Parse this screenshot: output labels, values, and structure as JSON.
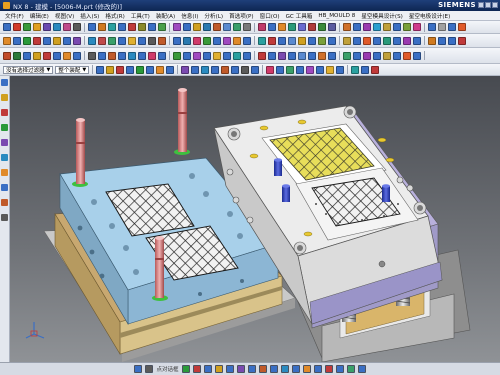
{
  "window": {
    "title": "NX 8 - 建模 - [5006-M.prt (修改的)]",
    "brand": "SIEMENS"
  },
  "menu": {
    "items": [
      "文件(F)",
      "编辑(E)",
      "视图(V)",
      "插入(S)",
      "格式(R)",
      "工具(T)",
      "装配(A)",
      "信息(I)",
      "分析(L)",
      "首选项(P)",
      "窗口(O)",
      "GC 工具箱",
      "HB_MOULD 8",
      "星空模具设计(S)",
      "星空电极设计(E)"
    ]
  },
  "toolbar": {
    "filter_type": "没有选择过滤器",
    "filter_scope": "整个装配",
    "row1_icons": [
      "#3a6fc4",
      "#d23a2a",
      "#3a9a3a",
      "#e0a020",
      "#6a4ab0",
      "#2a8ac0",
      "#c04a8a",
      "#5a5a5a",
      "#3a6fc4",
      "#d07a20",
      "#2aa0a0",
      "#3a6fc4",
      "#c03a3a",
      "#8a8a2a",
      "#3a6fc4",
      "#4aa04a",
      "#a04ac0",
      "#3a6fc4",
      "#d0a020",
      "#2a7ab0",
      "#c05a2a",
      "#5a8ad0",
      "#3aa06a",
      "#7a7a7a",
      "#c03a6a",
      "#3a6fc4",
      "#e08a2a",
      "#2a9a7a",
      "#6a6ad0",
      "#b03a3a",
      "#3a8a3a",
      "#5a5aa0",
      "#d0702a",
      "#3a6fc4",
      "#9a3ab0",
      "#2aa0d0",
      "#c0a03a",
      "#3a6fc4",
      "#7aa03a",
      "#d03a8a",
      "#3a6fc4",
      "#a0a0a0",
      "#3a6fc4",
      "#e05a2a"
    ],
    "row2_icons": [
      "#e08a2a",
      "#3a6fc4",
      "#2a9a3a",
      "#c03a3a",
      "#3a6fc4",
      "#d0a020",
      "#3a6fc4",
      "#7a4ab0",
      "#2a8ac0",
      "#c04a4a",
      "#3aa06a",
      "#3a6fc4",
      "#e0b030",
      "#3a6fc4",
      "#5a5a5a",
      "#c05a2a",
      "#3a6fc4",
      "#2a7ab0",
      "#d03a6a",
      "#3a9a3a",
      "#3a6fc4",
      "#a04ac0",
      "#e08a2a",
      "#3a6fc4",
      "#2aa0a0",
      "#c03a3a",
      "#3a6fc4",
      "#5a8ad0",
      "#d0a020",
      "#3a6fc4",
      "#7aa03a",
      "#3a6fc4",
      "#c0a03a",
      "#3a6fc4",
      "#e05a2a",
      "#3a6fc4",
      "#2a9a7a",
      "#3a6fc4",
      "#9a3ab0",
      "#3a6fc4",
      "#d07a20",
      "#3a6fc4",
      "#3a6fc4",
      "#c03a3a"
    ],
    "row3_icons": [
      "#c04a2a",
      "#2a7a3a",
      "#3a6fc4",
      "#d0a020",
      "#c03a3a",
      "#3a6fc4",
      "#e08a2a",
      "#3a6fc4",
      "#5a5a5a",
      "#3a6fc4",
      "#c05a2a",
      "#3a6fc4",
      "#2a8ac0",
      "#3a6fc4",
      "#d03a6a",
      "#3a6fc4",
      "#3a9a3a",
      "#3a6fc4",
      "#a04ac0",
      "#3a6fc4",
      "#e0b030",
      "#3a6fc4",
      "#2aa0a0",
      "#3a6fc4",
      "#c03a3a",
      "#3a6fc4",
      "#7a4ab0",
      "#3a6fc4",
      "#5a8ad0",
      "#3a6fc4",
      "#d0702a",
      "#3a6fc4",
      "#3aa06a",
      "#3a6fc4",
      "#9a3ab0",
      "#3a6fc4",
      "#c0a03a",
      "#3a6fc4",
      "#e05a2a",
      "#3a6fc4"
    ],
    "row4_icons": [
      "#3a6fc4",
      "#d0a020",
      "#c03a3a",
      "#3a6fc4",
      "#2a9a3a",
      "#3a6fc4",
      "#e08a2a",
      "#3a6fc4",
      "#7a4ab0",
      "#3a6fc4",
      "#2a8ac0",
      "#3a6fc4",
      "#c05a2a",
      "#3a6fc4",
      "#5a5a5a",
      "#3a6fc4",
      "#d03a6a",
      "#3a6fc4",
      "#3aa06a",
      "#3a6fc4",
      "#a04ac0",
      "#3a6fc4",
      "#e0b030",
      "#3a6fc4",
      "#2aa0a0",
      "#3a6fc4",
      "#c03a3a"
    ]
  },
  "sidebar": {
    "icons": [
      "part-navigator-icon",
      "assembly-navigator-icon",
      "constraint-icon",
      "reuse-library-icon",
      "history-icon",
      "roles-icon",
      "system-material-icon",
      "web-browser-icon",
      "process-studio-icon",
      "manufacturing-wizard-icon"
    ]
  },
  "statusbar": {
    "icons": [
      "#3a6fc4",
      "#5a5a5a",
      "#2a9a3a",
      "#c03a3a",
      "#3a6fc4",
      "#d0a020",
      "#3a6fc4",
      "#7a4ab0",
      "#3a6fc4",
      "#c05a2a",
      "#3a6fc4",
      "#2a8ac0",
      "#3a6fc4",
      "#e08a2a",
      "#3a6fc4",
      "#c03a3a",
      "#3a6fc4",
      "#3aa06a",
      "#3a6fc4"
    ],
    "label": "点对话框"
  },
  "colors": {
    "core_plate": "#9fc9e4",
    "cavity_plate": "#e9e9e9",
    "insert_yellow": "#e8de5a",
    "guide_pin": "#d98a8a",
    "support_blue": "#2e3fb8",
    "ejector_purple": "#9a94c8",
    "base_tan": "#d9c38a",
    "accent_green": "#3fbf3f"
  }
}
